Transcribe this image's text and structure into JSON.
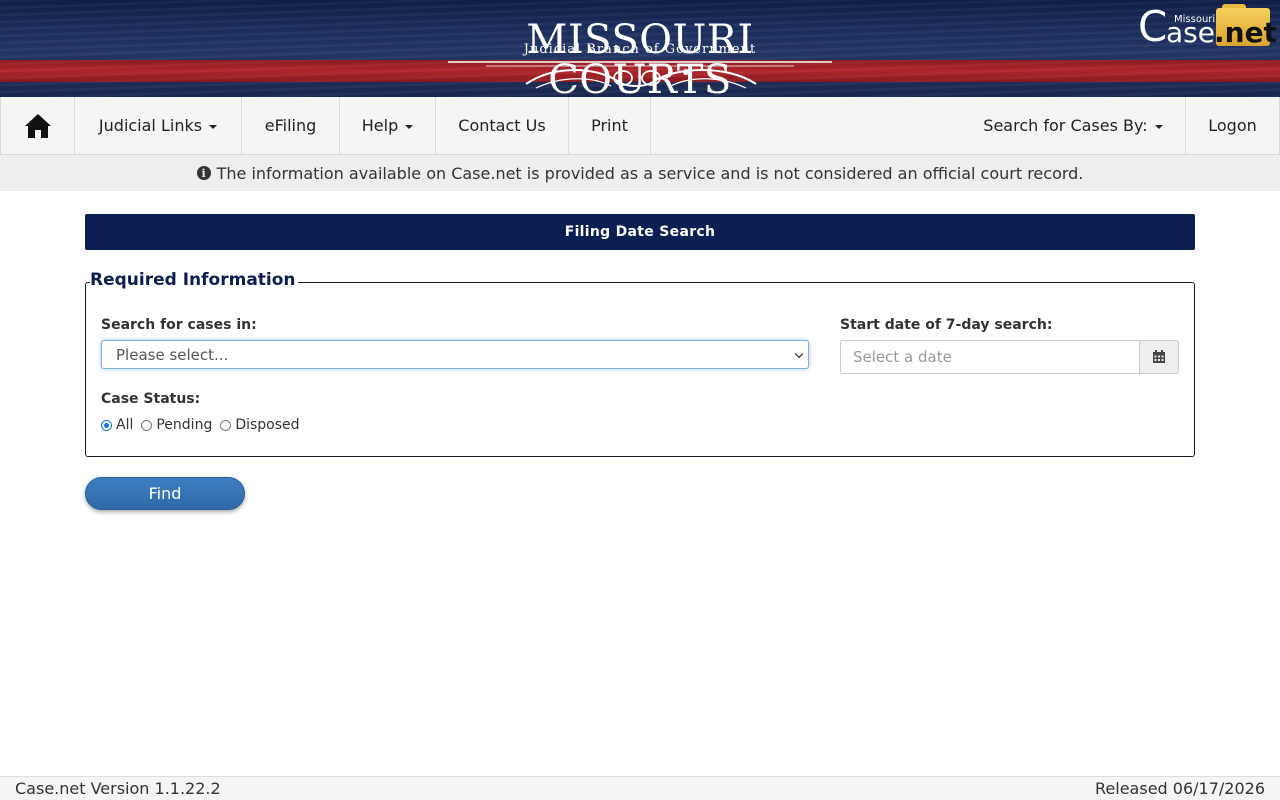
{
  "banner": {
    "seal_title": "MISSOURI COURTS",
    "seal_subtitle": "Judicial Branch of Government",
    "casenet_logo": {
      "missouri": "Missouri",
      "c": "C",
      "ase": "ase",
      "net": ".net"
    }
  },
  "navbar": {
    "home_icon": "home-icon",
    "items": [
      {
        "label": "Judicial Links",
        "dropdown": true
      },
      {
        "label": "eFiling",
        "dropdown": false
      },
      {
        "label": "Help",
        "dropdown": true
      },
      {
        "label": "Contact Us",
        "dropdown": false
      },
      {
        "label": "Print",
        "dropdown": false
      }
    ],
    "right_items": [
      {
        "label": "Search for Cases By:",
        "dropdown": true
      },
      {
        "label": "Logon",
        "dropdown": false
      }
    ]
  },
  "info_bar": {
    "icon": "info-circle-icon",
    "text": "The information available on Case.net is provided as a service and is not considered an official court record."
  },
  "panel": {
    "title": "Filing Date Search",
    "legend": "Required Information",
    "search_in_label": "Search for cases in:",
    "search_in_value": "Please select...",
    "start_date_label": "Start date of 7-day search:",
    "start_date_placeholder": "Select a date",
    "calendar_icon": "calendar-icon",
    "case_status_label": "Case Status:",
    "case_status_options": [
      "All",
      "Pending",
      "Disposed"
    ],
    "case_status_selected": "All",
    "find_button": "Find"
  },
  "footer": {
    "version": "Case.net Version 1.1.22.2",
    "released": "Released 06/17/2026"
  },
  "colors": {
    "navy": "#0c1f52",
    "banner_red": "#b3262c",
    "button_blue": "#3d7fc2"
  }
}
